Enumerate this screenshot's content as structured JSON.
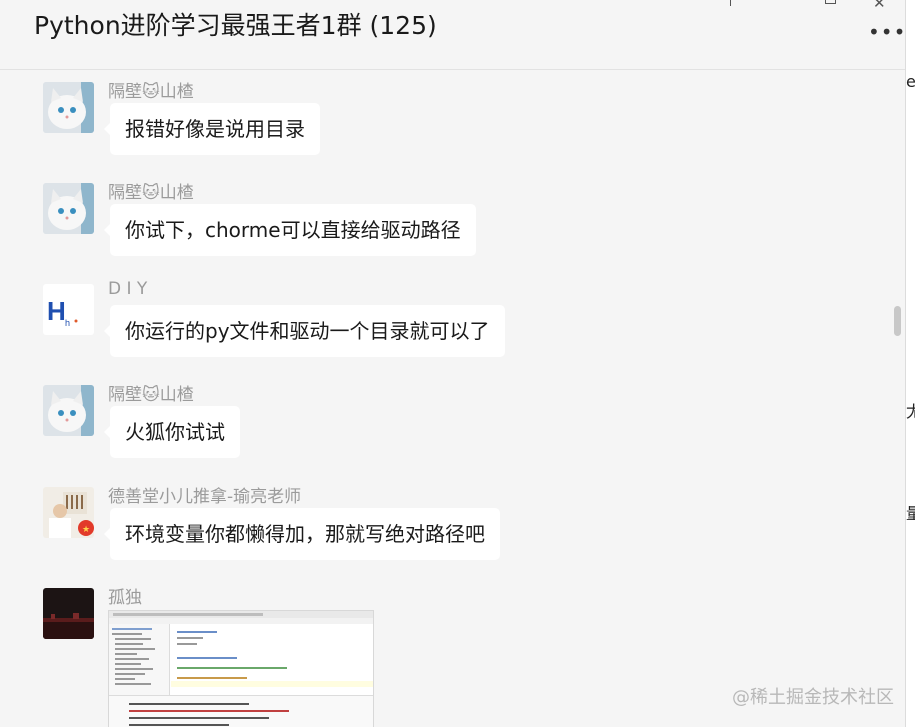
{
  "window": {
    "title": "Python进阶学习最强王者1群 (125)",
    "more_label": "•••",
    "close_label": "✕"
  },
  "messages": [
    {
      "sender": "隔壁🐱山楂",
      "avatar": "white-cat-avatar",
      "text": "报错好像是说用目录"
    },
    {
      "sender": "隔壁🐱山楂",
      "avatar": "white-cat-avatar",
      "text": "你试下，chorme可以直接给驱动路径"
    },
    {
      "sender": "D I Y",
      "avatar": "hh-logo-avatar",
      "avatar_text": "H",
      "avatar_subtext": "h",
      "text": "你运行的py文件和驱动一个目录就可以了"
    },
    {
      "sender": "隔壁🐱山楂",
      "avatar": "white-cat-avatar",
      "text": "火狐你试试"
    },
    {
      "sender": "德善堂小儿推拿-瑜亮老师",
      "avatar": "doctor-avatar",
      "text": "环境变量你都懒得加，那就写绝对路径吧"
    },
    {
      "sender": "孤独",
      "avatar": "dark-scenery-avatar",
      "image": "code-editor-screenshot"
    }
  ],
  "right_edge": [
    "e",
    "尢",
    "量"
  ],
  "watermark": "@稀土掘金技术社区",
  "colors": {
    "background": "#f5f5f5",
    "bubble": "#ffffff",
    "sender": "#9b9b9b",
    "hh_blue": "#1f4fb0"
  }
}
